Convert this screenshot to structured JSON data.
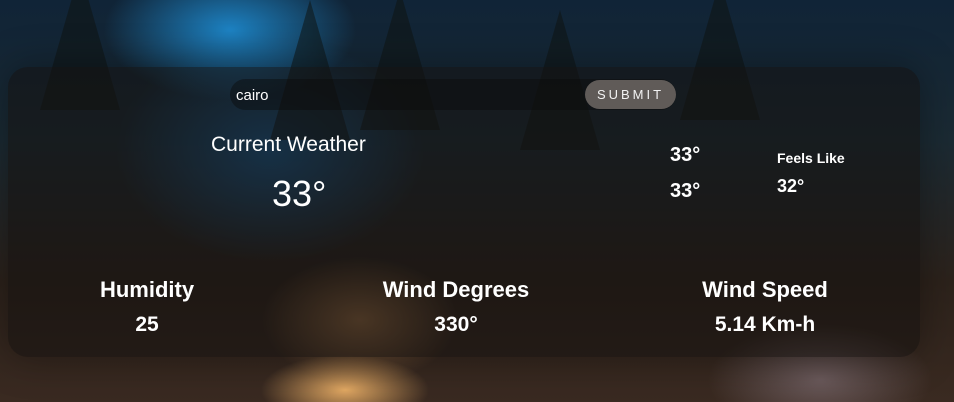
{
  "search": {
    "value": "cairo",
    "submit_label": "SUBMIT"
  },
  "current": {
    "title": "Current Weather",
    "temperature": "33°"
  },
  "details": {
    "temp_a": "33°",
    "temp_b": "33°",
    "feels_like_label": "Feels Like",
    "feels_like_value": "32°"
  },
  "stats": {
    "humidity_label": "Humidity",
    "humidity_value": "25",
    "wind_degrees_label": "Wind Degrees",
    "wind_degrees_value": "330°",
    "wind_speed_label": "Wind Speed",
    "wind_speed_value": "5.14 Km-h"
  }
}
